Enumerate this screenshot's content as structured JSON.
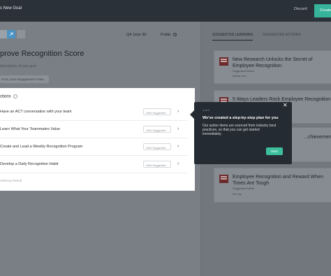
{
  "topbar": {
    "title": "s New Goal",
    "discard": "Discard",
    "create": "Create"
  },
  "goal": {
    "quarter": "Q4 June 30",
    "visibility": "Public",
    "title": "prove Recognition Score",
    "description": "description of your goal",
    "tag": "From June Engagement Pulse"
  },
  "actions": {
    "header": "ctions",
    "rows": [
      {
        "label": "Have an ACT conversation with your team",
        "badge": "Glint Suggested"
      },
      {
        "label": "Learn What Your Teammates Value",
        "badge": "Glint Suggested"
      },
      {
        "label": "Create and Lead a Weekly Recognition Program",
        "badge": "Glint Suggested"
      },
      {
        "label": "Develop a Daily Recognition Habit",
        "badge": "Glint Suggested"
      }
    ],
    "add_key_result": "Add Key Result"
  },
  "sidebar": {
    "tab_learning": "SUGGESTED LEARNING",
    "tab_actions": "SUGGESTED ACTIONS",
    "cards": [
      {
        "title": "New Research Unlocks the Secret of Employee Recognition",
        "type": "Suggested Article",
        "source": "forbes.com"
      },
      {
        "title": "5 Ways Leaders Rock Employee Recognition",
        "type": "",
        "source": ""
      },
      {
        "title": "...chievements",
        "type": "",
        "source": ""
      },
      {
        "title": "Employee Recognition and Reward When Times Are Tough",
        "type": "Suggested Article",
        "source": "hbr.org"
      }
    ]
  },
  "popover": {
    "step": "1 of 2",
    "title": "We've created a step-by-step plan for you",
    "body": "Our action items are sourced from industry best practices, so that you can get started immediately.",
    "next": "Next",
    "close": "✕"
  }
}
